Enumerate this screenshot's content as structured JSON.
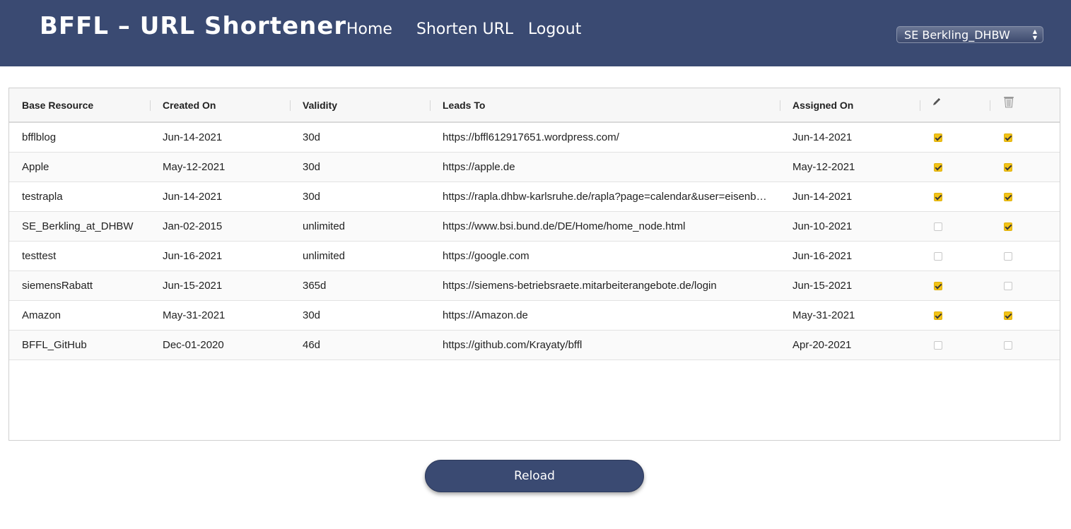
{
  "header": {
    "title": "BFFL – URL Shortener",
    "nav": [
      "Home",
      "Shorten URL",
      "Logout"
    ],
    "user_select": {
      "value": "SE Berkling_DHBW"
    }
  },
  "table": {
    "columns": [
      "Base Resource",
      "Created On",
      "Validity",
      "Leads To",
      "Assigned On"
    ],
    "action_columns": [
      "pencil-icon",
      "trash-icon"
    ],
    "rows": [
      {
        "base": "bfflblog",
        "created": "Jun-14-2021",
        "validity": "30d",
        "leads_to": "https://bffl612917651.wordpress.com/",
        "assigned": "Jun-14-2021",
        "edit": true,
        "delete": true
      },
      {
        "base": "Apple",
        "created": "May-12-2021",
        "validity": "30d",
        "leads_to": "https://apple.de",
        "assigned": "May-12-2021",
        "edit": true,
        "delete": true
      },
      {
        "base": "testrapla",
        "created": "Jun-14-2021",
        "validity": "30d",
        "leads_to": "https://rapla.dhbw-karlsruhe.de/rapla?page=calendar&user=eisenbie...",
        "assigned": "Jun-14-2021",
        "edit": true,
        "delete": true
      },
      {
        "base": "SE_Berkling_at_DHBW",
        "created": "Jan-02-2015",
        "validity": "unlimited",
        "leads_to": "https://www.bsi.bund.de/DE/Home/home_node.html",
        "assigned": "Jun-10-2021",
        "edit": false,
        "delete": true
      },
      {
        "base": "testtest",
        "created": "Jun-16-2021",
        "validity": "unlimited",
        "leads_to": "https://google.com",
        "assigned": "Jun-16-2021",
        "edit": false,
        "delete": false
      },
      {
        "base": "siemensRabatt",
        "created": "Jun-15-2021",
        "validity": "365d",
        "leads_to": "https://siemens-betriebsraete.mitarbeiterangebote.de/login",
        "assigned": "Jun-15-2021",
        "edit": true,
        "delete": false
      },
      {
        "base": "Amazon",
        "created": "May-31-2021",
        "validity": "30d",
        "leads_to": "https://Amazon.de",
        "assigned": "May-31-2021",
        "edit": true,
        "delete": true
      },
      {
        "base": "BFFL_GitHub",
        "created": "Dec-01-2020",
        "validity": "46d",
        "leads_to": "https://github.com/Krayaty/bffl",
        "assigned": "Apr-20-2021",
        "edit": false,
        "delete": false
      }
    ]
  },
  "reload_label": "Reload",
  "colors": {
    "header_bg": "#3a4a72",
    "checkbox_on": "#f3c317"
  }
}
